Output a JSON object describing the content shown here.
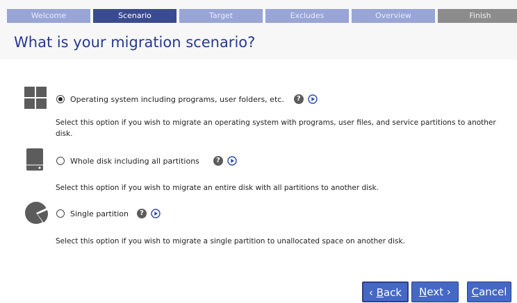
{
  "wizard": {
    "steps": [
      "Welcome",
      "Scenario",
      "Target",
      "Excludes",
      "Overview",
      "Finish"
    ],
    "active_step": "Scenario"
  },
  "page": {
    "title": "What is your migration scenario?"
  },
  "options": [
    {
      "label": "Operating system including programs, user folders, etc.",
      "description": "Select this option if you wish to migrate an operating system with programs, user files, and service partitions to another disk.",
      "selected": true,
      "icon": "windows-logo-icon"
    },
    {
      "label": "Whole disk including all partitions",
      "description": "Select this option if you wish to migrate an entire disk with all partitions to another disk.",
      "selected": false,
      "icon": "hard-disk-icon"
    },
    {
      "label": "Single partition",
      "description": "Select this option if you wish to migrate a single partition to unallocated space on another disk.",
      "selected": false,
      "icon": "partition-pie-icon"
    }
  ],
  "help_glyph": "?",
  "buttons": {
    "back": {
      "arrow": "‹ ",
      "mnemonic": "B",
      "rest": "ack"
    },
    "next": {
      "mnemonic": "N",
      "rest": "ext",
      "arrow": " ›"
    },
    "cancel": {
      "mnemonic": "C",
      "rest": "ancel"
    }
  },
  "colors": {
    "title": "#283a8c",
    "step_active": "#3b4b8f",
    "step_inactive": "#99a5d7",
    "step_finish": "#8c8c8c",
    "button": "#4568c5",
    "icon": "#5c5c5c",
    "play": "#2c4aa8"
  }
}
